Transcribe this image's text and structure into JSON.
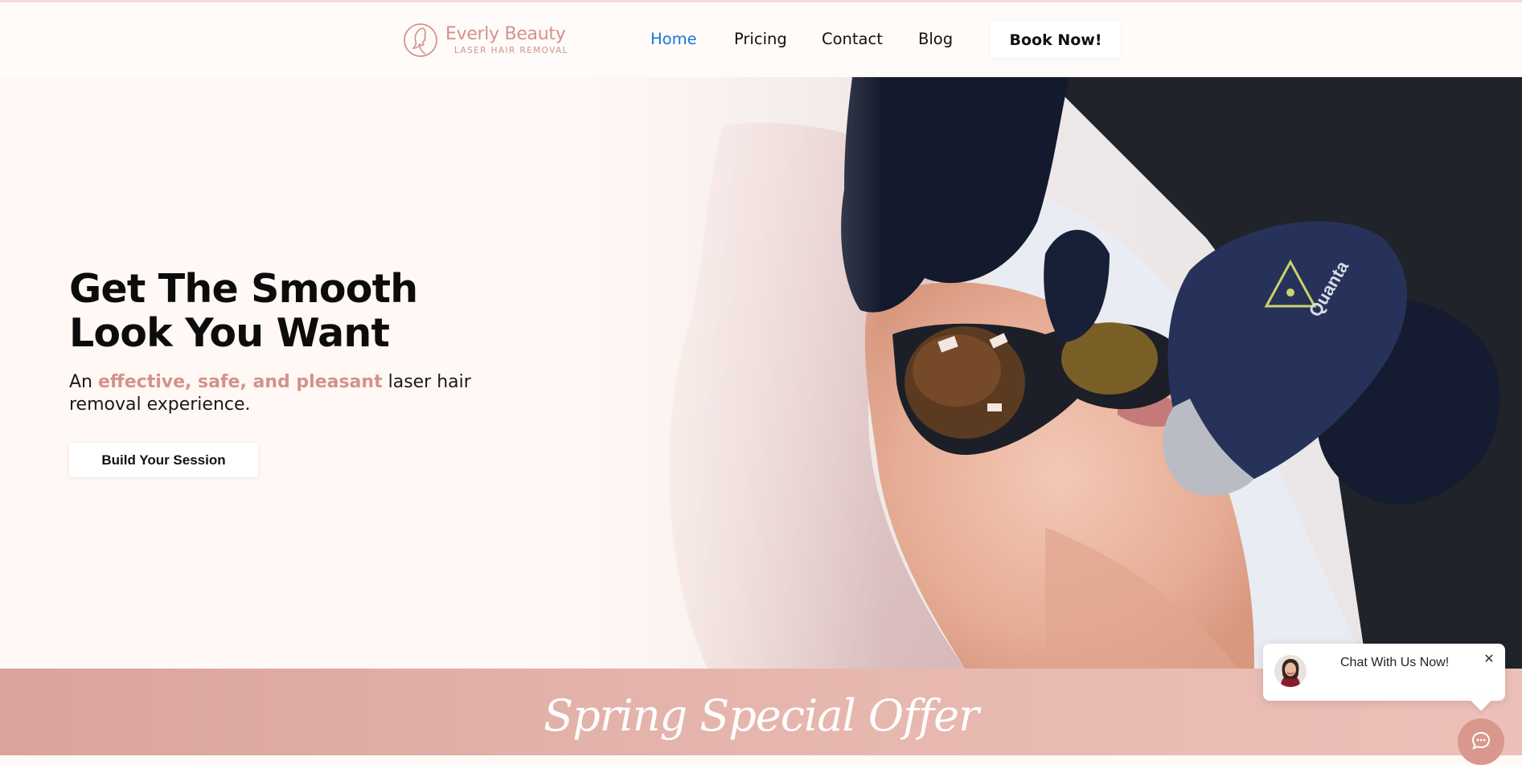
{
  "brand": {
    "name": "Everly Beauty",
    "tagline": "LASER HAIR REMOVAL",
    "logo_icon": "woman-profile-icon",
    "accent_color": "#d4928a"
  },
  "nav": {
    "items": [
      {
        "label": "Home",
        "active": true
      },
      {
        "label": "Pricing",
        "active": false
      },
      {
        "label": "Contact",
        "active": false
      },
      {
        "label": "Blog",
        "active": false
      }
    ],
    "cta_label": "Book Now!",
    "active_color": "#1a73d9"
  },
  "hero": {
    "title": "Get The Smooth Look You Want",
    "subtitle_pre": "An",
    "subtitle_highlight": "effective, safe, and pleasant",
    "subtitle_post": "laser hair removal experience.",
    "button_label": "Build Your Session",
    "image": "laser-hair-removal-treatment-photo"
  },
  "offer": {
    "title": "Spring Special Offer"
  },
  "chat": {
    "message": "Chat With Us Now!",
    "close_icon": "close-icon",
    "launcher_icon": "chat-bubble-icon"
  }
}
